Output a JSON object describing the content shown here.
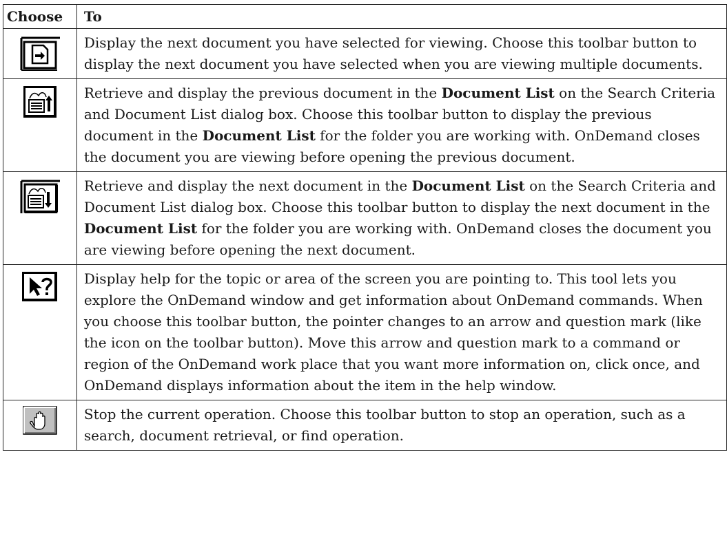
{
  "header": {
    "choose": "Choose",
    "to": "To"
  },
  "rows": [
    {
      "icon": "next-selected-document-icon",
      "parts": [
        {
          "t": "Display the next document you have selected for viewing. Choose this toolbar button to display the next document you have selected when you are viewing multiple documents.",
          "b": false
        }
      ]
    },
    {
      "icon": "previous-document-list-icon",
      "parts": [
        {
          "t": "Retrieve and display the previous document in the ",
          "b": false
        },
        {
          "t": "Document List",
          "b": true
        },
        {
          "t": " on the Search Criteria and Document List dialog box. Choose this toolbar button to display the previous document in the ",
          "b": false
        },
        {
          "t": "Document List",
          "b": true
        },
        {
          "t": " for the folder you are working with. OnDemand closes the document you are viewing before opening the previous document.",
          "b": false
        }
      ]
    },
    {
      "icon": "next-document-list-icon",
      "parts": [
        {
          "t": "Retrieve and display the next document in the ",
          "b": false
        },
        {
          "t": "Document List",
          "b": true
        },
        {
          "t": " on the Search Criteria and Document List dialog box. Choose this toolbar button to display the next document in the ",
          "b": false
        },
        {
          "t": "Document List",
          "b": true
        },
        {
          "t": " for the folder you are working with. OnDemand closes the document you are viewing before opening the next document.",
          "b": false
        }
      ]
    },
    {
      "icon": "context-help-icon",
      "parts": [
        {
          "t": "Display help for the topic or area of the screen you are pointing to. This tool lets you explore the OnDemand window and get information about OnDemand commands. When you choose this toolbar button, the pointer changes to an arrow and question mark (like the icon on the toolbar button). Move this arrow and question mark to a command or region of the OnDemand work place that you want more information on, click once, and OnDemand displays information about the item in the help window.",
          "b": false
        }
      ]
    },
    {
      "icon": "stop-hand-icon",
      "parts": [
        {
          "t": "Stop the current operation. Choose this toolbar button to stop an operation, such as a search, document retrieval, or find operation.",
          "b": false
        }
      ]
    }
  ]
}
